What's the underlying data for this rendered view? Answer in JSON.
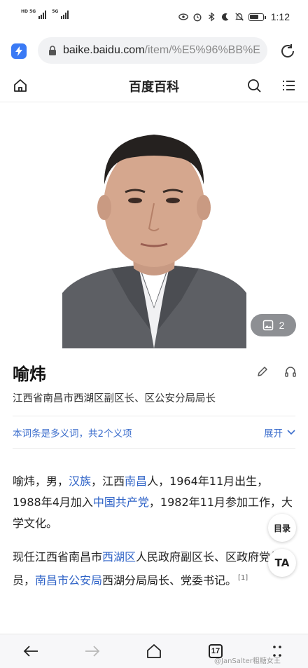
{
  "status_bar": {
    "network_1": "HD 5G",
    "network_2": "5G",
    "time": "1:12"
  },
  "browser": {
    "url_host": "baike.baidu.com",
    "url_path": "/item/%E5%96%BB%E",
    "tabs_count": "17"
  },
  "site": {
    "title": "百度百科"
  },
  "media": {
    "gallery_count": "2"
  },
  "entry": {
    "title": "喻炜",
    "subtitle": "江西省南昌市西湖区副区长、区公安分局局长",
    "polysemy_note": "本词条是多义词，共2个义项",
    "expand_label": "展开",
    "para1": {
      "t1": "喻炜，男，",
      "l1": "汉族",
      "t2": "，江西",
      "l2": "南昌",
      "t3": "人，1964年11月出生，1988年4月加入",
      "l3": "中国共产党",
      "t4": "，1982年11月参加工作，大学文化。"
    },
    "para2": {
      "t1": "现任江西省南昌市",
      "l1": "西湖区",
      "t2": "人民政府副区长、区政府党组成员，",
      "l2": "南昌市公安局",
      "t3": "西湖分局局长、党委书记。",
      "ref": "[1]"
    }
  },
  "floating": {
    "toc_label": "目录",
    "ta_label": "TA"
  },
  "watermark": "@JanSalter粗糖女王"
}
